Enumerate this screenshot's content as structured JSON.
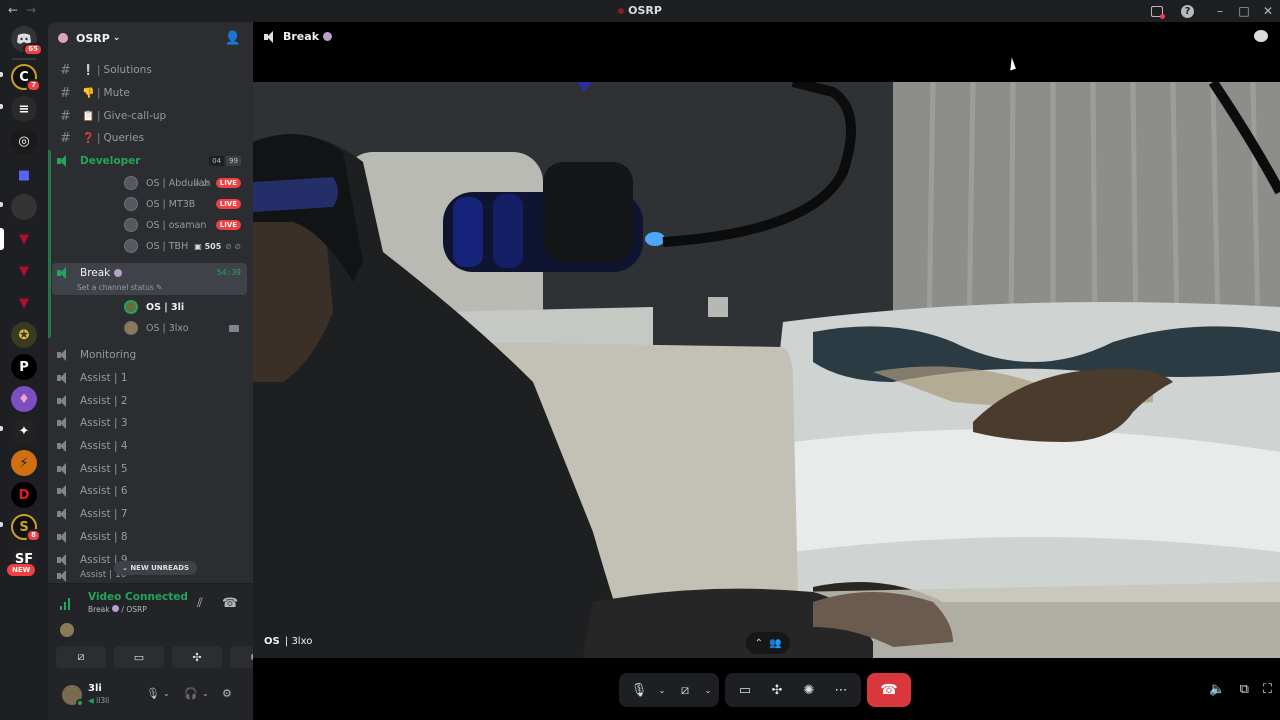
{
  "titlebar": {
    "title": "OSRP",
    "back": "←",
    "forward": "→",
    "help": "?"
  },
  "guilds": {
    "home_badge": "65",
    "second_badge": "7",
    "lower_badge": "8",
    "new_label": "NEW"
  },
  "server": {
    "name": "OSRP"
  },
  "text_channels": [
    {
      "emoji": "❕",
      "name": "Solutions"
    },
    {
      "emoji": "👎",
      "name": "Mute"
    },
    {
      "emoji": "📋",
      "name": "Give-call-up"
    },
    {
      "emoji": "❓",
      "name": "Queries"
    }
  ],
  "developer": {
    "name": "Developer",
    "count_a": "04",
    "count_b": "99",
    "users": [
      {
        "name": "OS | Abdullah",
        "live": "LIVE"
      },
      {
        "name": "OS | MT3B",
        "live": "LIVE"
      },
      {
        "name": "OS | osaman",
        "live": "LIVE"
      },
      {
        "name": "OS | TBH",
        "streak": "505"
      }
    ]
  },
  "break": {
    "name": "Break",
    "timer": "54:39",
    "status": "Set a channel status",
    "users": [
      {
        "name": "OS | 3li"
      },
      {
        "name": "OS | 3lxo"
      }
    ]
  },
  "voice_channels": [
    "Monitoring",
    "Assist | 1",
    "Assist | 2",
    "Assist | 3",
    "Assist | 4",
    "Assist | 5",
    "Assist | 6",
    "Assist | 7",
    "Assist | 8",
    "Assist | 9",
    "Assist | 10"
  ],
  "unreads": "NEW UNREADS",
  "rtc": {
    "status": "Video Connected",
    "channel": "Break",
    "server": "/ OSRP"
  },
  "user_panel": {
    "name": "3li",
    "username": "il3li"
  },
  "stage": {
    "channel_name": "Break",
    "video_user_prefix": "OS",
    "video_user_suffix": "| 3lxo"
  },
  "colors": {
    "online": "#23a55a",
    "live": "#f23f43",
    "hangup": "#da373c",
    "sidebar": "#2b2d31",
    "rail": "#1e1f22"
  }
}
